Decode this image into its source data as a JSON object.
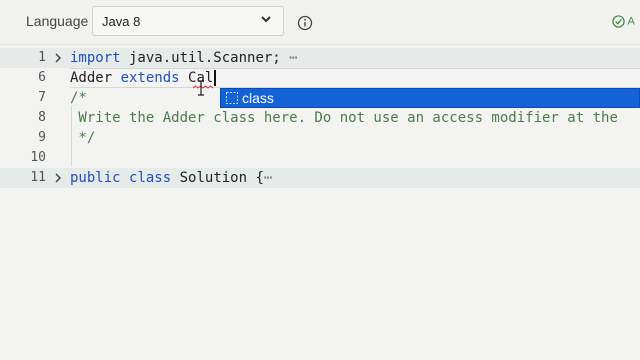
{
  "toolbar": {
    "language_label": "Language",
    "language_value": "Java 8",
    "status_text": "A",
    "icons": {
      "dropdown": "chevron-down-icon",
      "info": "info-icon",
      "status": "check-circle-icon"
    }
  },
  "editor": {
    "lines": [
      {
        "number": "1",
        "folded": true,
        "text_kw": "import",
        "text_rest": " java.util.Scanner;",
        "ellipsis": "⋯"
      },
      {
        "number": "6",
        "text_a": "Adder ",
        "text_kw": "extends",
        "text_b": " Cal"
      },
      {
        "number": "7",
        "text": "/*"
      },
      {
        "number": "8",
        "text": " Write the Adder class here. Do not use an access modifier at the"
      },
      {
        "number": "9",
        "text": " */"
      },
      {
        "number": "10",
        "text": ""
      },
      {
        "number": "11",
        "folded": true,
        "text_kw1": "public",
        "text_kw2": "class",
        "text_rest": " Solution {",
        "ellipsis": "⋯"
      }
    ]
  },
  "suggestion": {
    "label": "class",
    "icon": "keyword-icon"
  },
  "colors": {
    "keyword": "#1f4fc4",
    "comment": "#4b7c4b",
    "suggestion_bg": "#1462d8",
    "status": "#3d8b3d"
  }
}
